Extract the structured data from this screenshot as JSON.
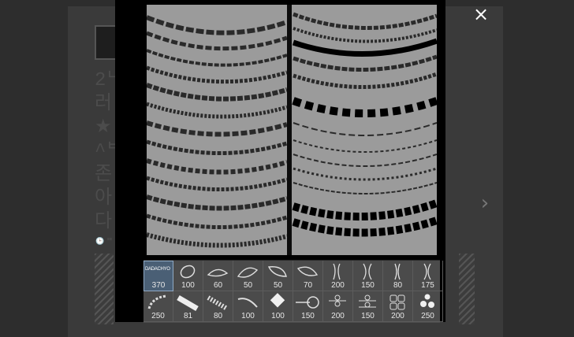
{
  "background": {
    "post_text_lines": [
      "2ᄂ",
      "러",
      "★",
      "^ᄇ",
      "존",
      "아",
      "다"
    ],
    "meta_text": "🕒 ᄐᄐ"
  },
  "viewer": {
    "close_icon": "×",
    "next_icon": "›"
  },
  "brush_panel": {
    "selected_brush_name": "DADACHYO",
    "row1_sizes": [
      "370",
      "100",
      "60",
      "50",
      "50",
      "70",
      "200",
      "150",
      "80",
      "175"
    ],
    "row2_sizes": [
      "250",
      "81",
      "80",
      "100",
      "100",
      "150",
      "200",
      "150",
      "200",
      "250"
    ]
  }
}
